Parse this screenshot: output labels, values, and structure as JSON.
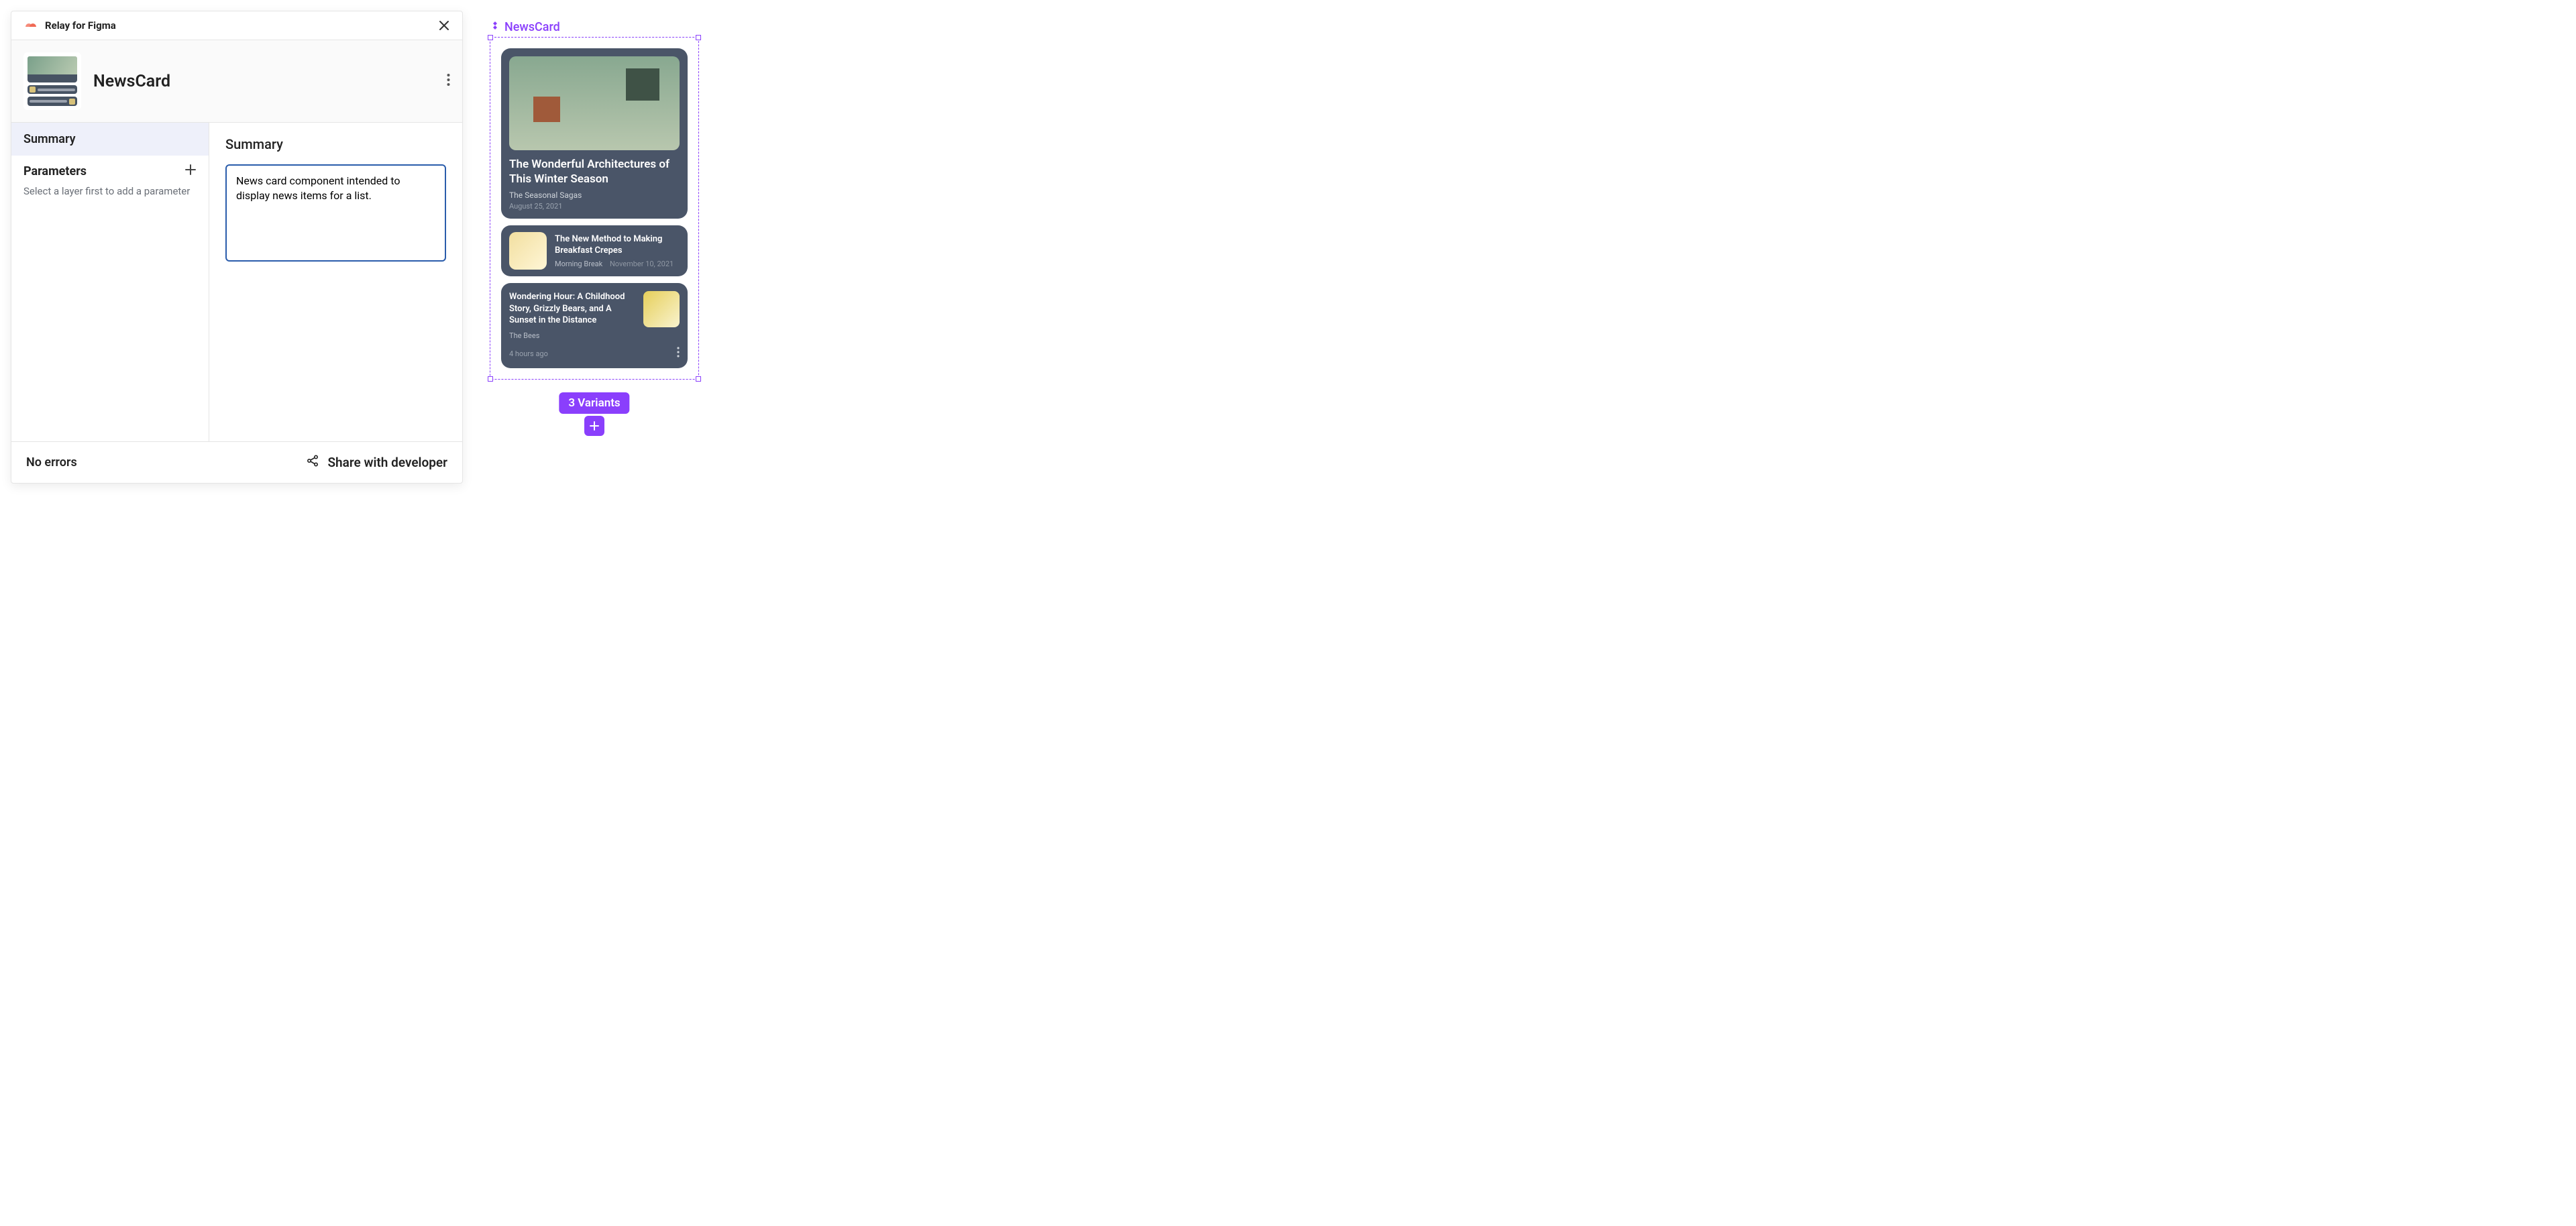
{
  "plugin": {
    "name": "Relay for Figma",
    "component_name": "NewsCard"
  },
  "sidebar": {
    "tab_summary": "Summary",
    "parameters_title": "Parameters",
    "parameters_hint": "Select a layer first to add a parameter"
  },
  "content": {
    "heading": "Summary",
    "summary_text": "News card component intended to display news items for a list."
  },
  "footer": {
    "status": "No errors",
    "share": "Share with developer"
  },
  "canvas": {
    "component_label": "NewsCard",
    "variants_label": "3 Variants",
    "cards": {
      "c1": {
        "title": "The Wonderful Architectures of This Winter Season",
        "author": "The Seasonal Sagas",
        "date": "August 25, 2021"
      },
      "c2": {
        "title": "The New Method to Making Breakfast Crepes",
        "author": "Morning Break",
        "date": "November 10, 2021"
      },
      "c3": {
        "title": "Wondering Hour: A Childhood Story, Grizzly Bears, and A Sunset in the Distance",
        "author": "The Bees",
        "ago": "4 hours ago"
      }
    }
  }
}
